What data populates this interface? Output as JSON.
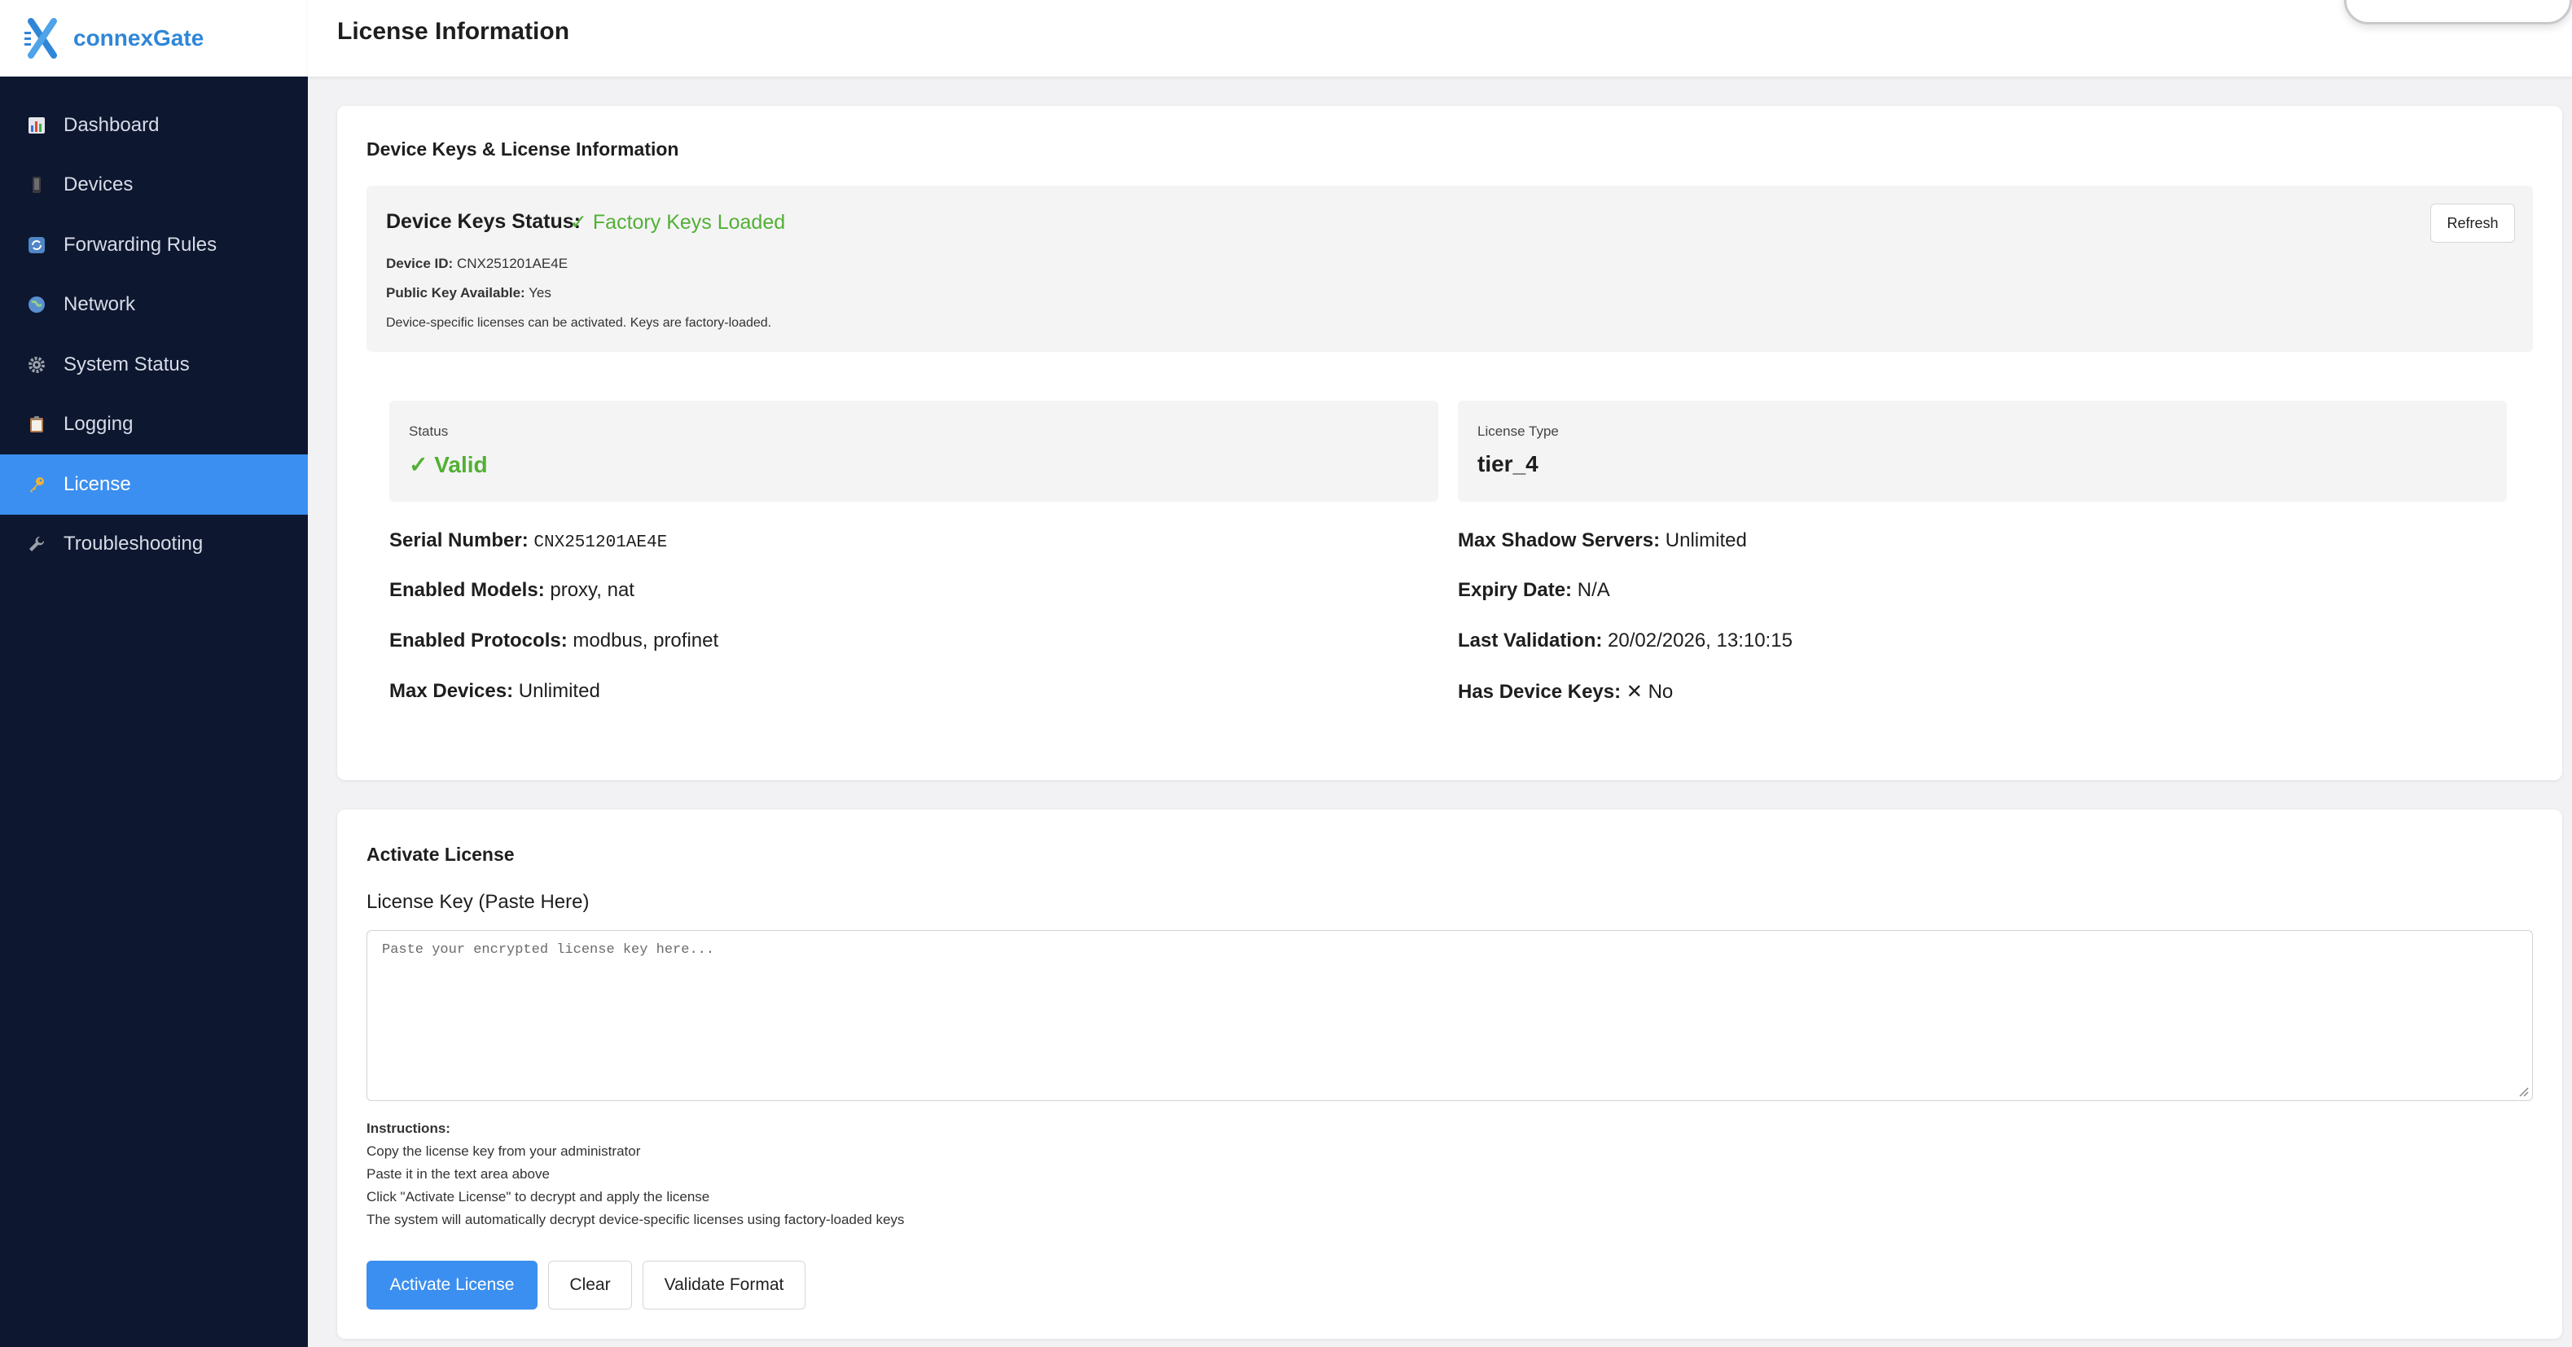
{
  "brand": {
    "name": "connexGate"
  },
  "sidebar": {
    "items": [
      {
        "label": "Dashboard",
        "icon": "bar-chart-icon"
      },
      {
        "label": "Devices",
        "icon": "mobile-device-icon"
      },
      {
        "label": "Forwarding Rules",
        "icon": "refresh-arrows-icon"
      },
      {
        "label": "Network",
        "icon": "globe-icon"
      },
      {
        "label": "System Status",
        "icon": "gear-icon"
      },
      {
        "label": "Logging",
        "icon": "clipboard-icon"
      },
      {
        "label": "License",
        "icon": "key-icon",
        "active": true
      },
      {
        "label": "Troubleshooting",
        "icon": "wrench-icon"
      }
    ]
  },
  "header": {
    "title": "License Information"
  },
  "keys_card": {
    "title": "Device Keys & License Information",
    "status_label": "Device Keys Status:",
    "status_value": "✓ Factory Keys Loaded",
    "refresh_label": "Refresh",
    "device_id_label": "Device ID:",
    "device_id_value": "CNX251201AE4E",
    "public_key_label": "Public Key Available:",
    "public_key_value": "Yes",
    "note": "Device-specific licenses can be activated. Keys are factory-loaded."
  },
  "license": {
    "status_label": "Status",
    "status_value": "✓ Valid",
    "type_label": "License Type",
    "type_value": "tier_4",
    "fields_left": [
      {
        "key": "Serial Number:",
        "value": "CNX251201AE4E"
      },
      {
        "key": "Enabled Models:",
        "value": "proxy, nat"
      },
      {
        "key": "Enabled Protocols:",
        "value": "modbus, profinet"
      },
      {
        "key": "Max Devices:",
        "value": "Unlimited"
      }
    ],
    "fields_right": [
      {
        "key": "Max Shadow Servers:",
        "value": "Unlimited"
      },
      {
        "key": "Expiry Date:",
        "value": "N/A"
      },
      {
        "key": "Last Validation:",
        "value": "20/02/2026, 13:10:15"
      },
      {
        "key": "Has Device Keys:",
        "value": "✕ No"
      }
    ]
  },
  "activate": {
    "title": "Activate License",
    "field_label": "License Key (Paste Here)",
    "placeholder": "Paste your encrypted license key here...",
    "instructions_title": "Instructions:",
    "instructions": [
      "Copy the license key from your administrator",
      "Paste it in the text area above",
      "Click \"Activate License\" to decrypt and apply the license",
      "The system will automatically decrypt device-specific licenses using factory-loaded keys"
    ],
    "buttons": {
      "activate": "Activate License",
      "clear": "Clear",
      "validate": "Validate Format"
    }
  },
  "colors": {
    "sidebar_bg": "#0d1730",
    "accent": "#3b8ff0",
    "brand": "#2f86d8",
    "success": "#52b034"
  }
}
